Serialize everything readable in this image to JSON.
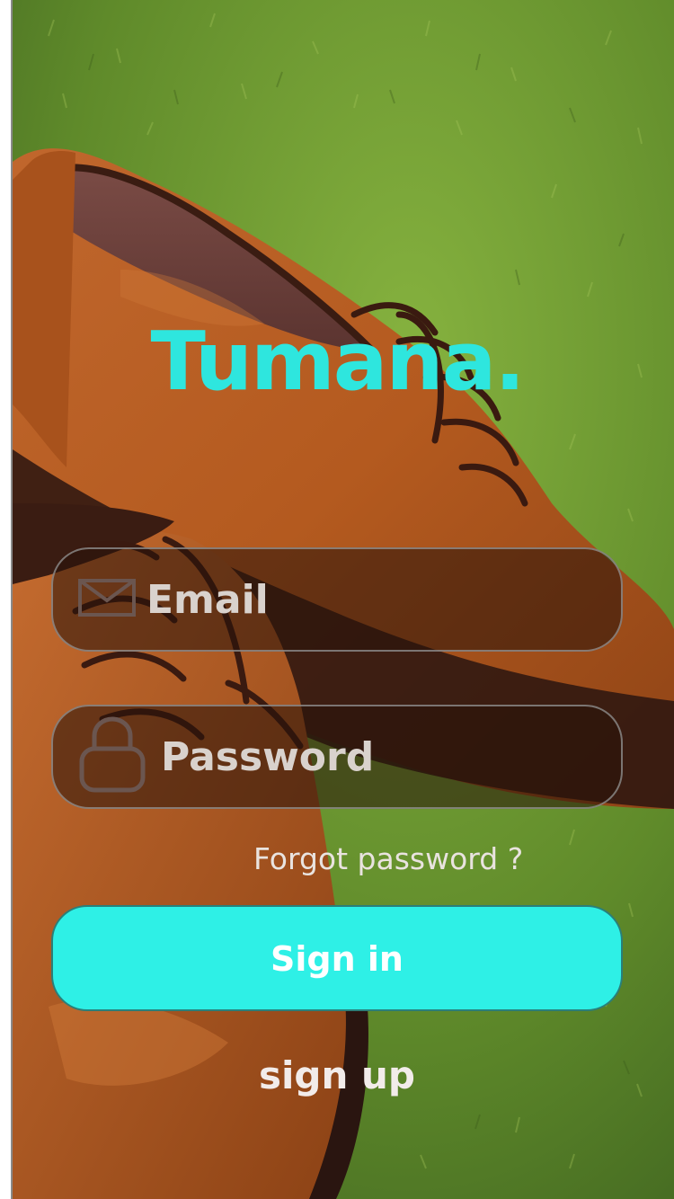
{
  "app": {
    "brand": "Tumana.",
    "brand_color": "#2ee6de",
    "background_image": "brown leather oxford shoes on grass"
  },
  "login": {
    "email": {
      "placeholder": "Email",
      "value": "",
      "icon": "envelope-icon"
    },
    "password": {
      "placeholder": "Password",
      "value": "",
      "icon": "lock-icon"
    },
    "forgot_label": "Forgot password ?",
    "signin_label": "Sign in",
    "signin_color": "#2ef0e6",
    "signup_label": "sign up"
  }
}
